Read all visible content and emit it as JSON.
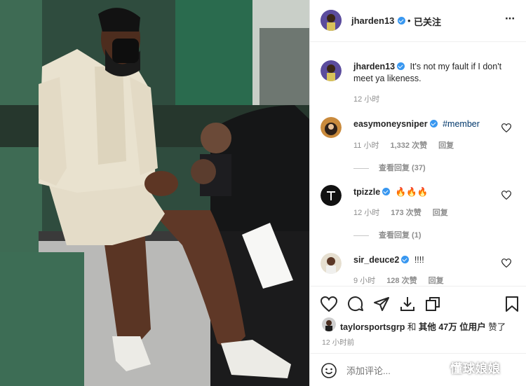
{
  "header": {
    "username": "jharden13",
    "separator": "•",
    "follow_status": "已关注",
    "more": "···"
  },
  "caption": {
    "username": "jharden13",
    "text": "It's not my fault if I don't meet ya likeness.",
    "time": "12 小时"
  },
  "comments": [
    {
      "username": "easymoneysniper",
      "text": "#member",
      "time": "11 小时",
      "likes": "1,332 次赞",
      "reply": "回复",
      "view_replies": "查看回复 (37)"
    },
    {
      "username": "tpizzle",
      "text": "🔥🔥🔥",
      "time": "12 小时",
      "likes": "173 次赞",
      "reply": "回复",
      "view_replies": "查看回复 (1)"
    },
    {
      "username": "sir_deuce2",
      "text": "!!!!",
      "time": "9 小时",
      "likes": "128 次赞",
      "reply": "回复"
    }
  ],
  "likes_line": {
    "user": "taylorsportsgrp",
    "and": "和",
    "others": "其他 47万 位用户",
    "suffix": "赞了"
  },
  "post_time": "12 小时前",
  "comment_input": {
    "placeholder": "添加评论..."
  },
  "watermark": "懂球娘娘",
  "icons": [
    "heart-icon",
    "comment-icon",
    "share-icon",
    "save-icon",
    "bookmark-icon",
    "emoji-icon",
    "more-icon"
  ]
}
